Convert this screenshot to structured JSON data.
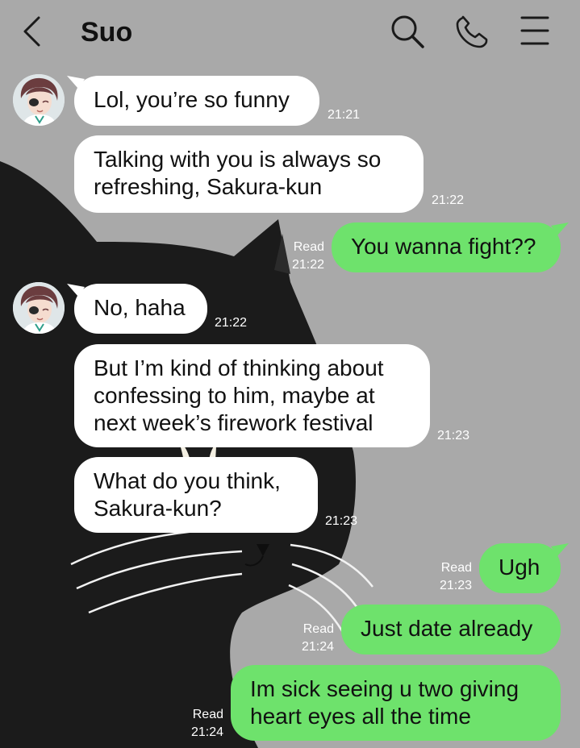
{
  "header": {
    "title": "Suo",
    "back_icon": "chevron-left-icon",
    "search_icon": "search-icon",
    "call_icon": "phone-icon",
    "menu_icon": "menu-icon"
  },
  "colors": {
    "outgoing_bubble": "#6ee26c",
    "incoming_bubble": "#ffffff",
    "background": "#a9a9a9",
    "meta_text": "#ffffff"
  },
  "messages": [
    {
      "sender": "Suo",
      "lines": [
        "Lol, you’re so funny"
      ],
      "time": "21:21"
    },
    {
      "sender": "Suo",
      "lines": [
        "Talking with you is always so",
        "refreshing, Sakura-kun"
      ],
      "time": "21:22"
    },
    {
      "sender": "me",
      "lines": [
        "You wanna fight??"
      ],
      "read": "Read",
      "time": "21:22"
    },
    {
      "sender": "Suo",
      "lines": [
        "No, haha"
      ],
      "time": "21:22"
    },
    {
      "sender": "Suo",
      "lines": [
        "But I’m kind of thinking about",
        "confessing to him, maybe at",
        "next week’s firework festival"
      ],
      "time": "21:23"
    },
    {
      "sender": "Suo",
      "lines": [
        "What do you think,",
        "Sakura-kun?"
      ],
      "time": "21:23"
    },
    {
      "sender": "me",
      "lines": [
        "Ugh"
      ],
      "read": "Read",
      "time": "21:23"
    },
    {
      "sender": "me",
      "lines": [
        "Just date already"
      ],
      "read": "Read",
      "time": "21:24"
    },
    {
      "sender": "me",
      "lines": [
        "Im sick seeing u two giving",
        "heart eyes all the time"
      ],
      "read": "Read",
      "time": "21:24"
    }
  ]
}
